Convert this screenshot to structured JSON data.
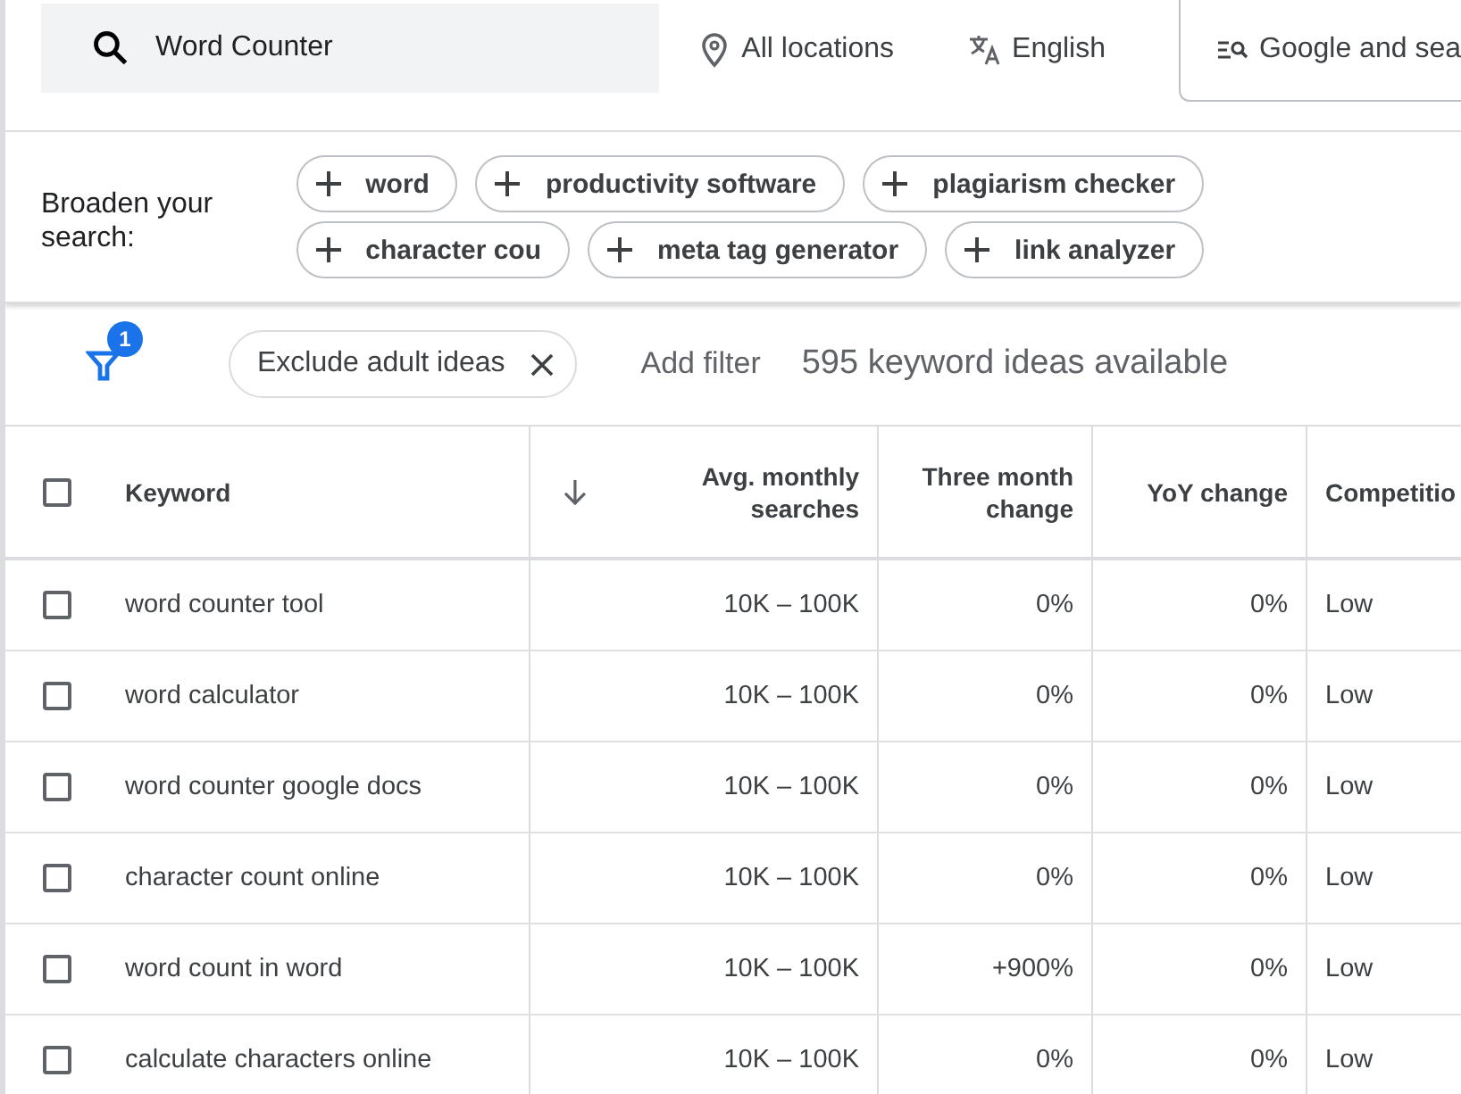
{
  "search_bar": {
    "query": "Word Counter",
    "location": "All locations",
    "language": "English",
    "network": "Google and sea"
  },
  "broaden": {
    "label": "Broaden your search:",
    "chips": [
      "word",
      "productivity software",
      "plagiarism checker",
      "character cou",
      "meta tag generator",
      "link analyzer"
    ]
  },
  "filters": {
    "badge": "1",
    "chips": [
      "Exclude adult ideas"
    ],
    "add_filter": "Add filter",
    "summary": "595 keyword ideas available"
  },
  "table": {
    "select_all_checked": false,
    "columns": [
      "Keyword",
      "Avg. monthly searches",
      "Three month change",
      "YoY change",
      "Competitio"
    ],
    "rows": [
      {
        "keyword": "word counter tool",
        "searches": "10K – 100K",
        "three_month": "0%",
        "yoy": "0%",
        "competition": "Low",
        "checked": false
      },
      {
        "keyword": "word calculator",
        "searches": "10K – 100K",
        "three_month": "0%",
        "yoy": "0%",
        "competition": "Low",
        "checked": false
      },
      {
        "keyword": "word counter google docs",
        "searches": "10K – 100K",
        "three_month": "0%",
        "yoy": "0%",
        "competition": "Low",
        "checked": false
      },
      {
        "keyword": "character count online",
        "searches": "10K – 100K",
        "three_month": "0%",
        "yoy": "0%",
        "competition": "Low",
        "checked": false
      },
      {
        "keyword": "word count in word",
        "searches": "10K – 100K",
        "three_month": "+900%",
        "yoy": "0%",
        "competition": "Low",
        "checked": false
      },
      {
        "keyword": "calculate characters online",
        "searches": "10K – 100K",
        "three_month": "0%",
        "yoy": "0%",
        "competition": "Low",
        "checked": false
      }
    ]
  }
}
